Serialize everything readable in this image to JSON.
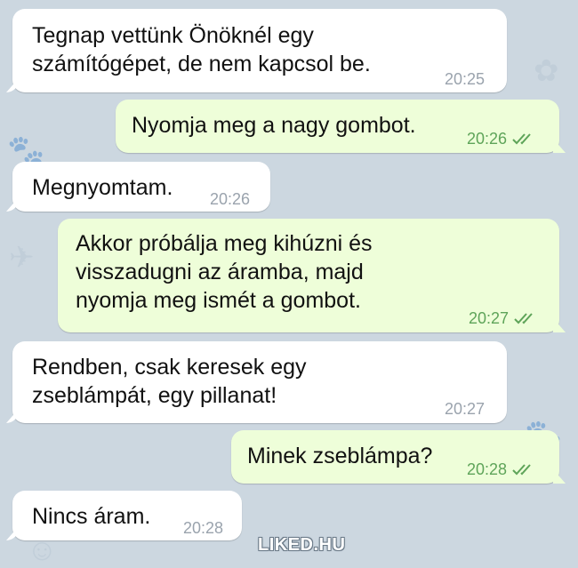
{
  "messages": [
    {
      "direction": "in",
      "text": "Tegnap vettünk Önöknél egy\nszámítógépet, de nem kapcsol be.",
      "time": "20:25"
    },
    {
      "direction": "out",
      "text": "Nyomja meg a nagy gombot.",
      "time": "20:26",
      "status_icon": "double-check-icon"
    },
    {
      "direction": "in",
      "text": "Megnyomtam.",
      "time": "20:26"
    },
    {
      "direction": "out",
      "text": "Akkor próbálja meg kihúzni és\nvisszadugni az áramba, majd\nnyomja meg ismét a gombot.",
      "time": "20:27",
      "status_icon": "double-check-icon"
    },
    {
      "direction": "in",
      "text": "Rendben, csak keresek egy\nzseblámpát, egy pillanat!",
      "time": "20:27"
    },
    {
      "direction": "out",
      "text": "Minek zseblámpa?",
      "time": "20:28",
      "status_icon": "double-check-icon"
    },
    {
      "direction": "in",
      "text": "Nincs áram.",
      "time": "20:28"
    }
  ],
  "watermark": "LIKED.HU",
  "colors": {
    "background": "#ccd7e0",
    "incoming_bubble": "#ffffff",
    "outgoing_bubble": "#eefed9",
    "outgoing_meta": "#5ea459",
    "incoming_meta": "#9aa3ad"
  }
}
